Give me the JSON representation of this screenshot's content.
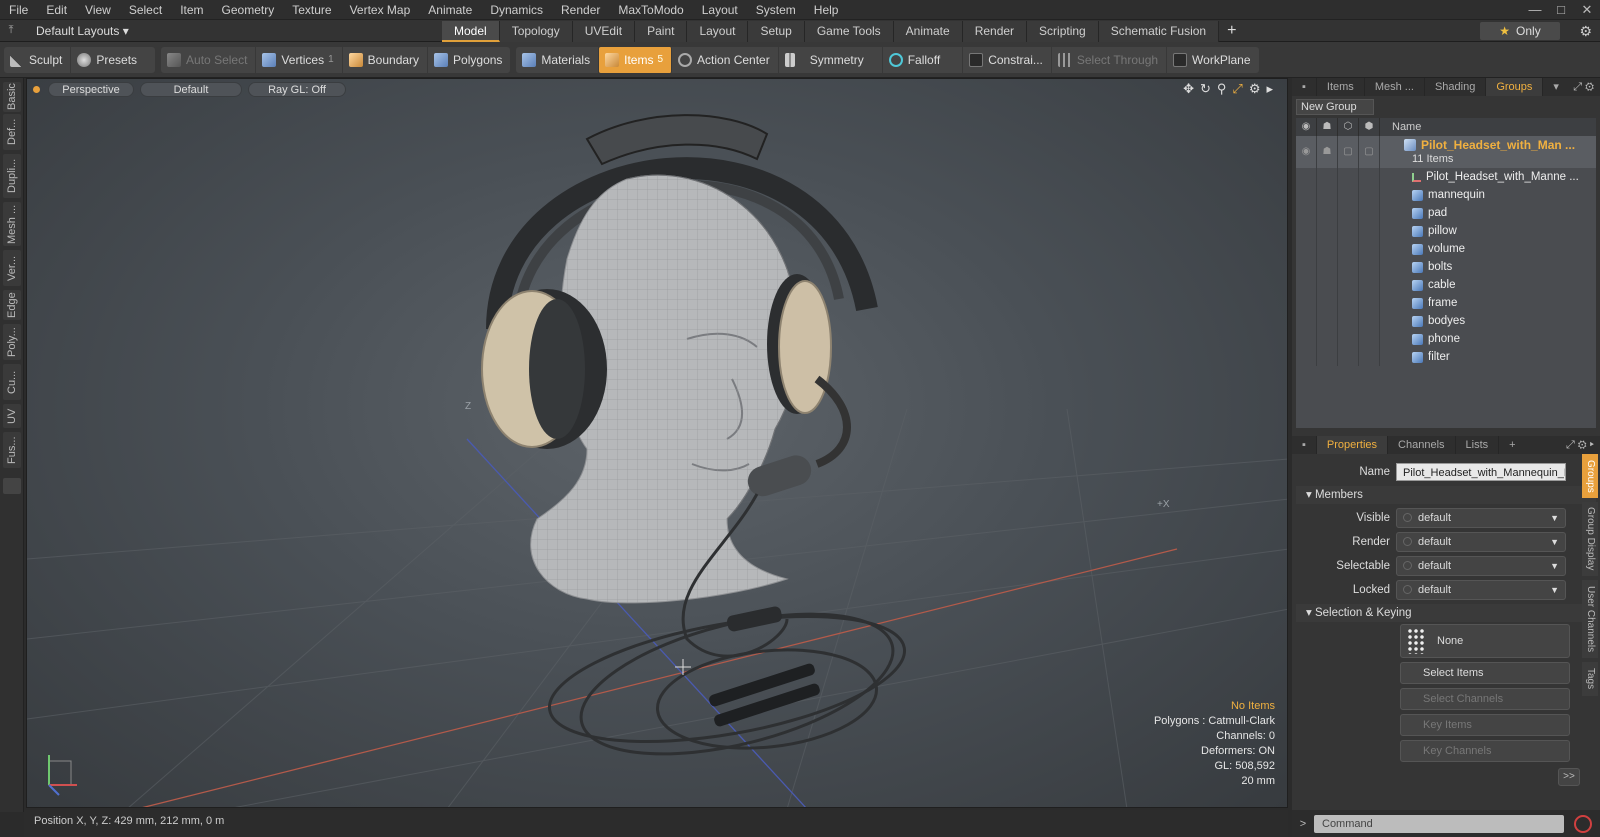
{
  "menu": [
    "File",
    "Edit",
    "View",
    "Select",
    "Item",
    "Geometry",
    "Texture",
    "Vertex Map",
    "Animate",
    "Dynamics",
    "Render",
    "MaxToModo",
    "Layout",
    "System",
    "Help"
  ],
  "layouts": {
    "dropdown": "Default Layouts",
    "tabs": [
      "Model",
      "Topology",
      "UVEdit",
      "Paint",
      "Layout",
      "Setup",
      "Game Tools",
      "Animate",
      "Render",
      "Scripting",
      "Schematic Fusion"
    ],
    "active_tab": "Model",
    "plus": "+",
    "only_label": "Only"
  },
  "toolbar": {
    "sculpt": "Sculpt",
    "presets": "Presets",
    "auto_select": "Auto Select",
    "vertices": "Vertices",
    "vertices_count": "1",
    "boundary": "Boundary",
    "polygons": "Polygons",
    "materials": "Materials",
    "items": "Items",
    "items_count": "5",
    "action_center": "Action Center",
    "symmetry": "Symmetry",
    "falloff": "Falloff",
    "constraints": "Constrai...",
    "select_through": "Select Through",
    "workplane": "WorkPlane"
  },
  "left_tabs": [
    "Basic",
    "Def...",
    "Dupli...",
    "Mesh ...",
    "Ver...",
    "Edge",
    "Poly...",
    "Cu...",
    "UV",
    "Fus..."
  ],
  "viewport": {
    "view": "Perspective",
    "shading": "Default",
    "raygl": "Ray GL: Off",
    "info": {
      "selection": "No Items",
      "polygons": "Polygons : Catmull-Clark",
      "channels": "Channels: 0",
      "deformers": "Deformers: ON",
      "gl": "GL: 508,592",
      "scale": "20 mm"
    },
    "axis_label_z": "Z",
    "axis_label_x": "+X"
  },
  "status": {
    "position": "Position X, Y, Z:  429 mm, 212 mm, 0 m"
  },
  "items_panel": {
    "tabs": [
      "Items",
      "Mesh ...",
      "Shading",
      "Groups"
    ],
    "active_tab": "Groups",
    "new_group": "New Group",
    "name_header": "Name",
    "group": {
      "title": "Pilot_Headset_with_Man ...",
      "count": "11 Items"
    },
    "children": [
      {
        "name": "Pilot_Headset_with_Manne ...",
        "type": "locator"
      },
      {
        "name": "mannequin",
        "type": "mesh"
      },
      {
        "name": "pad",
        "type": "mesh"
      },
      {
        "name": "pillow",
        "type": "mesh"
      },
      {
        "name": "volume",
        "type": "mesh"
      },
      {
        "name": "bolts",
        "type": "mesh"
      },
      {
        "name": "cable",
        "type": "mesh"
      },
      {
        "name": "frame",
        "type": "mesh"
      },
      {
        "name": "bodyes",
        "type": "mesh"
      },
      {
        "name": "phone",
        "type": "mesh"
      },
      {
        "name": "filter",
        "type": "mesh"
      }
    ]
  },
  "properties": {
    "tabs": [
      "Properties",
      "Channels",
      "Lists"
    ],
    "active_tab": "Properties",
    "plus": "+",
    "name_label": "Name",
    "name_value": "Pilot_Headset_with_Mannequin_H",
    "members_section": "Members",
    "visible_label": "Visible",
    "visible_value": "default",
    "render_label": "Render",
    "render_value": "default",
    "selectable_label": "Selectable",
    "selectable_value": "default",
    "locked_label": "Locked",
    "locked_value": "default",
    "selkey_section": "Selection & Keying",
    "none_label": "None",
    "select_items": "Select Items",
    "select_channels": "Select Channels",
    "key_items": "Key Items",
    "key_channels": "Key Channels",
    "more": ">>",
    "side_tabs": [
      "Groups",
      "Group Display",
      "User Channels",
      "Tags"
    ]
  },
  "command": {
    "arrow": ">",
    "placeholder": "Command"
  }
}
